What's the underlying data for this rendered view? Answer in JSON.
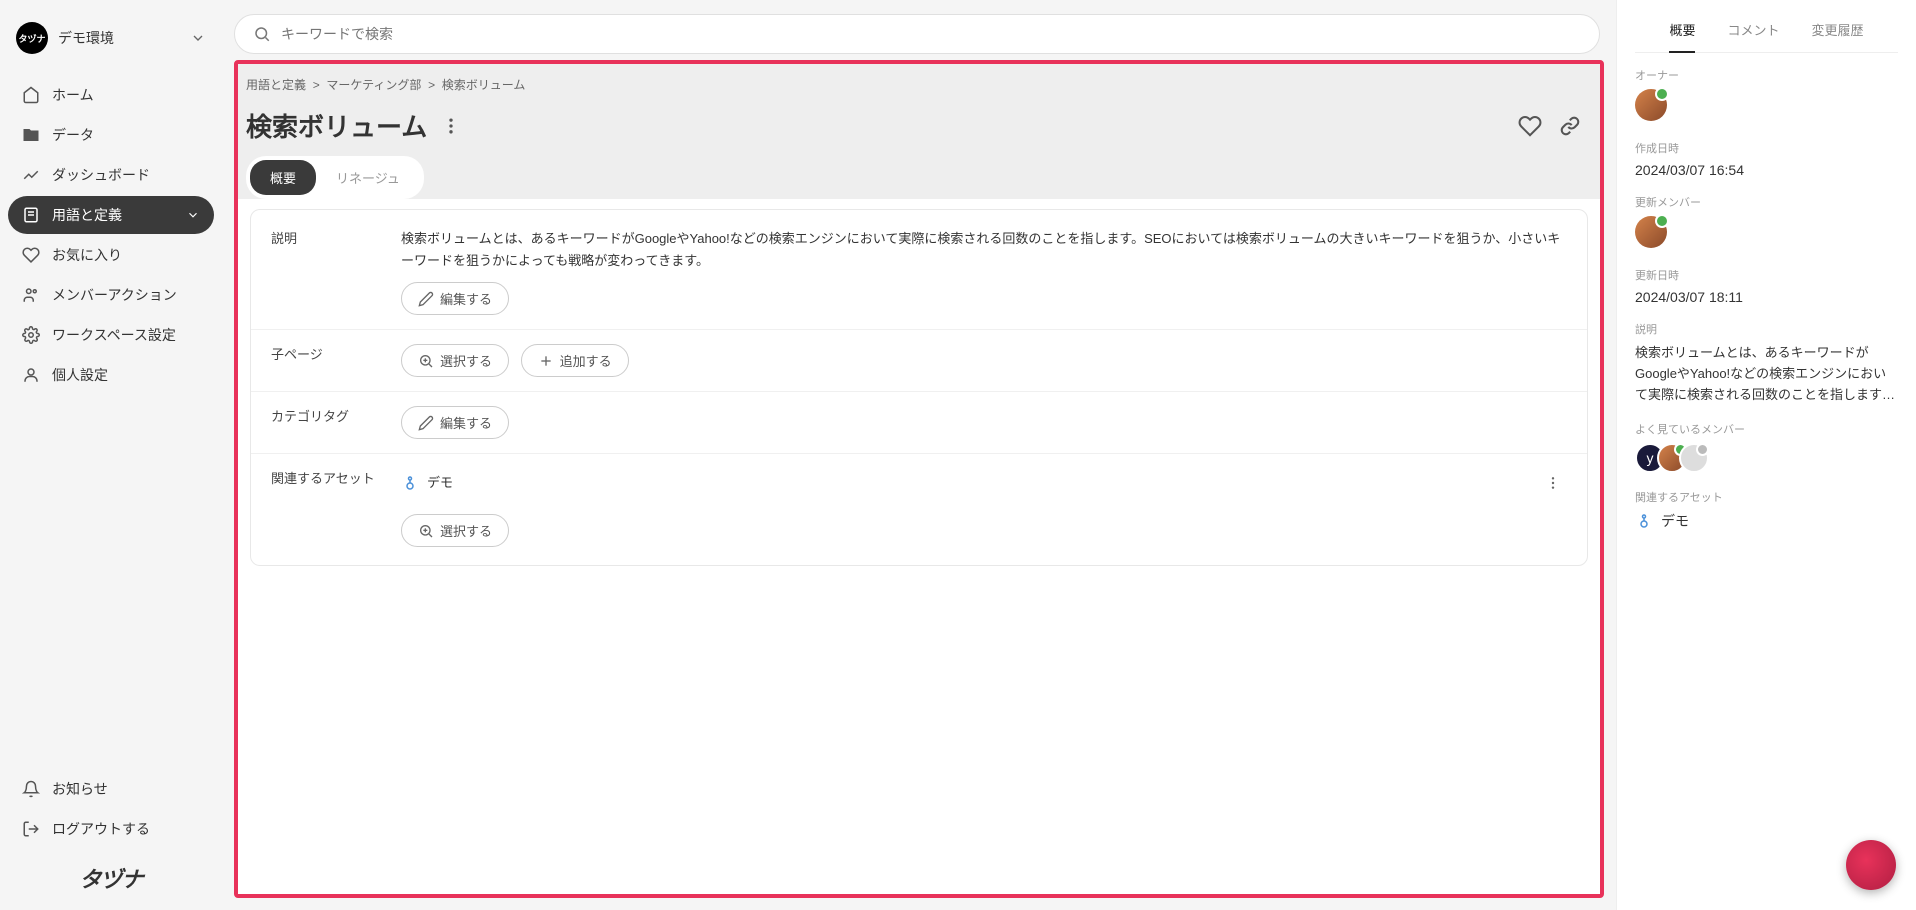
{
  "workspace": {
    "name": "デモ環境",
    "avatar_text": "タヅナ"
  },
  "sidebar": {
    "items": [
      {
        "label": "ホーム",
        "name": "nav-home"
      },
      {
        "label": "データ",
        "name": "nav-data"
      },
      {
        "label": "ダッシュボード",
        "name": "nav-dashboard"
      },
      {
        "label": "用語と定義",
        "name": "nav-terms",
        "active": true,
        "expandable": true
      },
      {
        "label": "お気に入り",
        "name": "nav-favorites"
      },
      {
        "label": "メンバーアクション",
        "name": "nav-member-actions"
      },
      {
        "label": "ワークスペース設定",
        "name": "nav-workspace-settings"
      },
      {
        "label": "個人設定",
        "name": "nav-personal-settings"
      }
    ],
    "bottom": [
      {
        "label": "お知らせ",
        "name": "nav-notifications"
      },
      {
        "label": "ログアウトする",
        "name": "nav-logout"
      }
    ],
    "logo": "タヅナ"
  },
  "search": {
    "placeholder": "キーワードで検索"
  },
  "breadcrumb": [
    "用語と定義",
    "マーケティング部",
    "検索ボリューム"
  ],
  "breadcrumb_sep": ">",
  "page": {
    "title": "検索ボリューム",
    "tabs": [
      {
        "label": "概要",
        "active": true
      },
      {
        "label": "リネージュ"
      }
    ],
    "fields": {
      "description": {
        "label": "説明",
        "value": "検索ボリュームとは、あるキーワードがGoogleやYahoo!などの検索エンジンにおいて実際に検索される回数のことを指します。SEOにおいては検索ボリュームの大きいキーワードを狙うか、小さいキーワードを狙うかによっても戦略が変わってきます。",
        "edit_btn": "編集する"
      },
      "child_pages": {
        "label": "子ページ",
        "select_btn": "選択する",
        "add_btn": "追加する"
      },
      "category_tags": {
        "label": "カテゴリタグ",
        "edit_btn": "編集する"
      },
      "related_assets": {
        "label": "関連するアセット",
        "items": [
          {
            "name": "デモ"
          }
        ],
        "select_btn": "選択する"
      }
    }
  },
  "right_panel": {
    "tabs": [
      {
        "label": "概要",
        "active": true
      },
      {
        "label": "コメント"
      },
      {
        "label": "変更履歴"
      }
    ],
    "owner": {
      "label": "オーナー"
    },
    "created": {
      "label": "作成日時",
      "value": "2024/03/07 16:54"
    },
    "updated_by": {
      "label": "更新メンバー"
    },
    "updated": {
      "label": "更新日時",
      "value": "2024/03/07 18:11"
    },
    "description": {
      "label": "説明",
      "value": "検索ボリュームとは、あるキーワードがGoogleやYahoo!などの検索エンジンにおいて実際に検索される回数のことを指します…"
    },
    "frequent_viewers": {
      "label": "よく見ているメンバー",
      "avatars": [
        "y",
        "",
        ""
      ]
    },
    "related_assets": {
      "label": "関連するアセット",
      "items": [
        "デモ"
      ]
    }
  }
}
